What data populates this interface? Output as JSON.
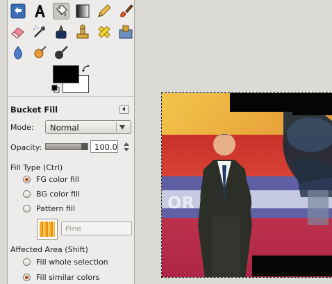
{
  "toolbox": {
    "tools": [
      {
        "name": "move-tool-icon",
        "active": false
      },
      {
        "name": "text-tool-icon",
        "active": false
      },
      {
        "name": "bucket-fill-tool-icon",
        "active": true
      },
      {
        "name": "blend-tool-icon",
        "active": false
      },
      {
        "name": "pencil-tool-icon",
        "active": false
      },
      {
        "name": "paintbrush-tool-icon",
        "active": false
      },
      {
        "name": "eraser-tool-icon",
        "active": false
      },
      {
        "name": "airbrush-tool-icon",
        "active": false
      },
      {
        "name": "ink-tool-icon",
        "active": false
      },
      {
        "name": "clone-tool-icon",
        "active": false
      },
      {
        "name": "heal-tool-icon",
        "active": false
      },
      {
        "name": "perspective-clone-tool-icon",
        "active": false
      },
      {
        "name": "blur-sharpen-tool-icon",
        "active": false
      },
      {
        "name": "smudge-tool-icon",
        "active": false
      },
      {
        "name": "dodge-burn-tool-icon",
        "active": false
      }
    ],
    "colors": {
      "foreground": "#000000",
      "background": "#ffffff"
    }
  },
  "tool_options": {
    "title": "Bucket Fill",
    "mode": {
      "label": "Mode:",
      "value": "Normal"
    },
    "opacity": {
      "label": "Opacity:",
      "value": "100.0",
      "fraction": 1.0
    },
    "fill_type": {
      "label": "Fill Type  (Ctrl)",
      "options": [
        {
          "label": "FG color fill",
          "checked": true
        },
        {
          "label": "BG color fill",
          "checked": false
        },
        {
          "label": "Pattern fill",
          "checked": false
        }
      ]
    },
    "pattern": {
      "name": "Pine"
    },
    "affected_area": {
      "label": "Affected Area  (Shift)",
      "options": [
        {
          "label": "Fill whole selection",
          "checked": false
        },
        {
          "label": "Fill similar colors",
          "checked": true
        }
      ]
    }
  },
  "colors": {
    "accent_radio": "#b84a12",
    "selection_border": "#222222"
  }
}
